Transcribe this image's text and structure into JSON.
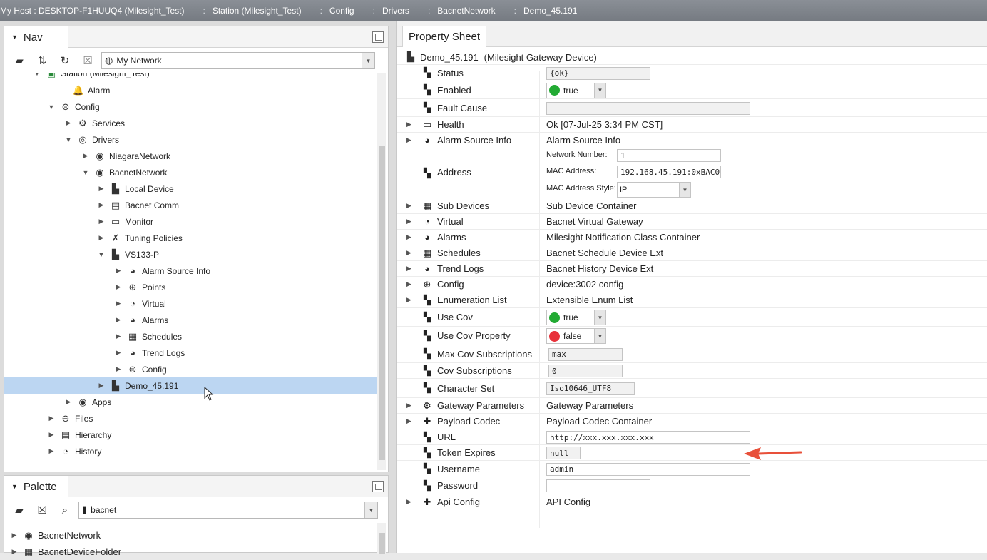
{
  "breadcrumb": [
    "My Host : DESKTOP-F1HUUQ4 (Milesight_Test)",
    "Station (Milesight_Test)",
    "Config",
    "Drivers",
    "BacnetNetwork",
    "Demo_45.191"
  ],
  "nav": {
    "title": "Nav",
    "network_combo": "My Network",
    "tree": [
      {
        "label": "Station (Milesight_Test)",
        "icon": "station-icon",
        "expander": "open"
      },
      {
        "label": "Alarm",
        "icon": "bell-icon",
        "expander": "none"
      },
      {
        "label": "Config",
        "icon": "config-icon",
        "expander": "open"
      },
      {
        "label": "Services",
        "icon": "services-icon",
        "expander": "closed"
      },
      {
        "label": "Drivers",
        "icon": "drivers-icon",
        "expander": "open"
      },
      {
        "label": "NiagaraNetwork",
        "icon": "network-icon",
        "expander": "closed"
      },
      {
        "label": "BacnetNetwork",
        "icon": "network-icon",
        "expander": "open"
      },
      {
        "label": "Local Device",
        "icon": "local-device-icon",
        "expander": "closed"
      },
      {
        "label": "Bacnet Comm",
        "icon": "comm-icon",
        "expander": "closed"
      },
      {
        "label": "Monitor",
        "icon": "monitor-icon",
        "expander": "closed"
      },
      {
        "label": "Tuning Policies",
        "icon": "tuning-icon",
        "expander": "closed"
      },
      {
        "label": "VS133-P",
        "icon": "device-icon",
        "expander": "open"
      },
      {
        "label": "Alarm Source Info",
        "icon": "alarm-source-icon",
        "expander": "closed"
      },
      {
        "label": "Points",
        "icon": "points-icon",
        "expander": "closed"
      },
      {
        "label": "Virtual",
        "icon": "virtual-icon",
        "expander": "closed"
      },
      {
        "label": "Alarms",
        "icon": "alarms-icon",
        "expander": "closed"
      },
      {
        "label": "Schedules",
        "icon": "schedules-icon",
        "expander": "closed"
      },
      {
        "label": "Trend Logs",
        "icon": "trend-icon",
        "expander": "closed"
      },
      {
        "label": "Config",
        "icon": "config-icon",
        "expander": "closed"
      },
      {
        "label": "Demo_45.191",
        "icon": "device-icon",
        "expander": "closed",
        "selected": true
      },
      {
        "label": "Apps",
        "icon": "apps-icon",
        "expander": "closed"
      },
      {
        "label": "Files",
        "icon": "files-icon",
        "expander": "closed"
      },
      {
        "label": "Hierarchy",
        "icon": "hierarchy-icon",
        "expander": "closed"
      },
      {
        "label": "History",
        "icon": "history-icon",
        "expander": "closed"
      }
    ]
  },
  "palette": {
    "title": "Palette",
    "combo": "bacnet",
    "items": [
      "BacnetNetwork",
      "BacnetDeviceFolder"
    ]
  },
  "property_sheet": {
    "tab": "Property Sheet",
    "object_name": "Demo_45.191",
    "object_type": "(Milesight Gateway Device)",
    "rows": {
      "status": {
        "name": "Status",
        "value": "{ok}"
      },
      "enabled": {
        "name": "Enabled",
        "value": "true"
      },
      "fault_cause": {
        "name": "Fault Cause",
        "value": ""
      },
      "health": {
        "name": "Health",
        "value": "Ok [07-Jul-25 3:34 PM CST]"
      },
      "alarm_source_info": {
        "name": "Alarm Source Info",
        "value": "Alarm Source Info"
      },
      "address": {
        "name": "Address",
        "network_number_label": "Network Number:",
        "network_number": "1",
        "mac_label": "MAC Address:",
        "mac": "192.168.45.191:0xBAC0",
        "mac_style_label": "MAC Address Style:",
        "mac_style": "IP"
      },
      "sub_devices": {
        "name": "Sub Devices",
        "value": "Sub Device Container"
      },
      "virtual": {
        "name": "Virtual",
        "value": "Bacnet Virtual Gateway"
      },
      "alarms": {
        "name": "Alarms",
        "value": "Milesight Notification Class Container"
      },
      "schedules": {
        "name": "Schedules",
        "value": "Bacnet Schedule Device Ext"
      },
      "trend_logs": {
        "name": "Trend Logs",
        "value": "Bacnet History Device Ext"
      },
      "config": {
        "name": "Config",
        "value": "device:3002 config"
      },
      "enumeration_list": {
        "name": "Enumeration List",
        "value": "Extensible Enum List"
      },
      "use_cov": {
        "name": "Use Cov",
        "value": "true"
      },
      "use_cov_property": {
        "name": "Use Cov Property",
        "value": "false"
      },
      "max_cov_subscriptions": {
        "name": "Max Cov Subscriptions",
        "value": "max"
      },
      "cov_subscriptions": {
        "name": "Cov Subscriptions",
        "value": "0"
      },
      "character_set": {
        "name": "Character Set",
        "value": "Iso10646_UTF8"
      },
      "gateway_parameters": {
        "name": "Gateway Parameters",
        "value": "Gateway Parameters"
      },
      "payload_codec": {
        "name": "Payload Codec",
        "value": "Payload Codec Container"
      },
      "url": {
        "name": "URL",
        "value": "http://xxx.xxx.xxx.xxx"
      },
      "token_expires": {
        "name": "Token Expires",
        "value": "null"
      },
      "username": {
        "name": "Username",
        "value": "admin"
      },
      "password": {
        "name": "Password",
        "value": ""
      },
      "api_config": {
        "name": "Api Config",
        "value": "API Config"
      }
    }
  },
  "colors": {
    "true_dot": "#22aa33",
    "false_dot": "#e8313a",
    "selection": "#bcd6f2",
    "annotation_arrow": "#e8503a"
  }
}
